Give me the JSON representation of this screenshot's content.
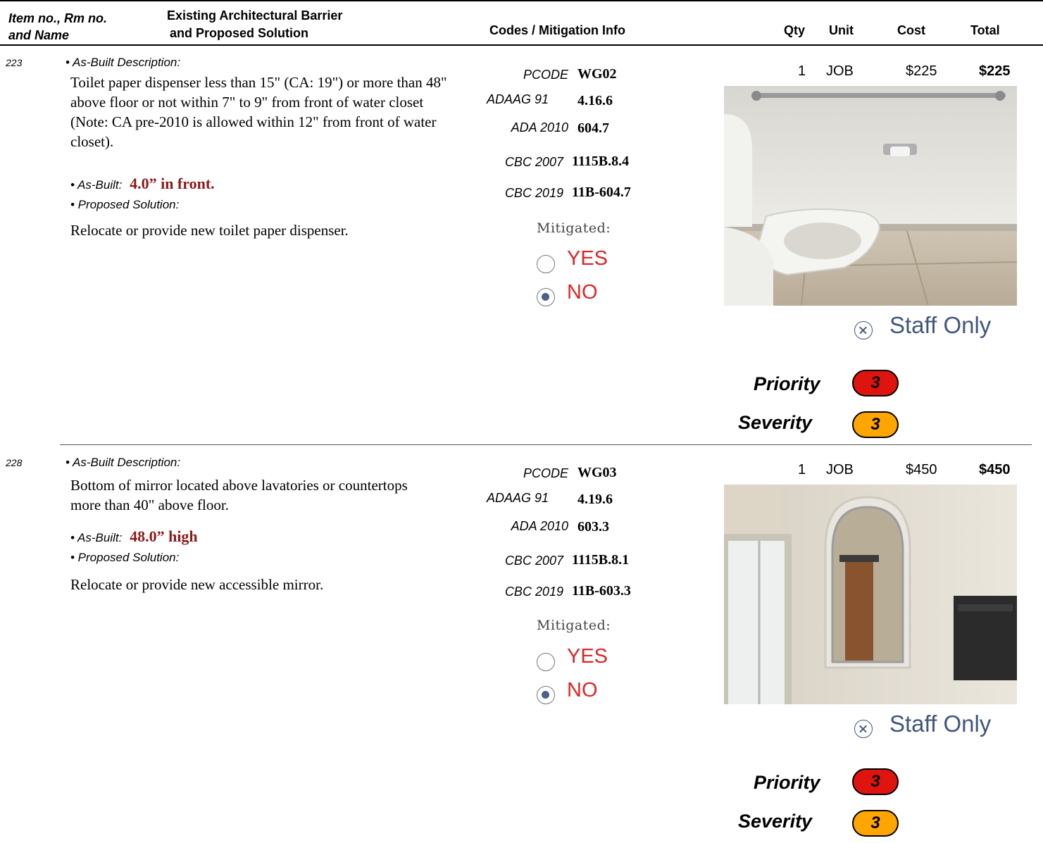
{
  "header": {
    "col_item_line1": "Item no., Rm no.",
    "col_item_line2": "and Name",
    "col_barrier_line1": "Existing Architectural Barrier",
    "col_barrier_line2": "and Proposed Solution",
    "col_codes": "Codes / Mitigation Info",
    "col_qty": "Qty",
    "col_unit": "Unit",
    "col_cost": "Cost",
    "col_total": "Total"
  },
  "labels": {
    "asbuilt_desc": "• As-Built Description:",
    "asbuilt": "• As-Built:",
    "proposed": "• Proposed Solution:",
    "mitigated": "Mitigated:",
    "yes": "YES",
    "no": "NO",
    "staff_only": "Staff Only",
    "priority": "Priority",
    "severity": "Severity"
  },
  "colors": {
    "priority_pill": "#e0140f",
    "severity_pill": "#ffa500",
    "asbuilt_value": "#8b1a1a",
    "option_text": "#e02424",
    "staff_text": "#41567e"
  },
  "items": [
    {
      "number": "223",
      "description": "Toilet paper dispenser less than 15\" (CA: 19\") or more than 48\" above floor or not within 7\" to 9\" from front of water closet (Note: CA pre-2010 is allowed within 12\" from front of water closet).",
      "asbuilt_value": "4.0” in front.",
      "proposed_solution": "Relocate or provide new toilet paper dispenser.",
      "codes": {
        "pcode_label": "PCODE",
        "pcode": "WG02",
        "adaag_label": "ADAAG 91",
        "adaag": "4.16.6",
        "ada_label": "ADA 2010",
        "ada": "604.7",
        "cbc07_label": "CBC 2007",
        "cbc07": "1115B.8.4",
        "cbc19_label": "CBC 2019",
        "cbc19": "11B-604.7"
      },
      "mitigated": "NO",
      "qty": "1",
      "unit": "JOB",
      "cost": "$225",
      "total": "$225",
      "photo": "toilet-photo",
      "priority": "3",
      "severity": "3"
    },
    {
      "number": "228",
      "description": "Bottom of mirror located above lavatories or countertops more than 40\" above floor.",
      "asbuilt_value": "48.0” high",
      "proposed_solution": "Relocate or provide new accessible mirror.",
      "codes": {
        "pcode_label": "PCODE",
        "pcode": "WG03",
        "adaag_label": "ADAAG 91",
        "adaag": "4.19.6",
        "ada_label": "ADA 2010",
        "ada": "603.3",
        "cbc07_label": "CBC 2007",
        "cbc07": "1115B.8.1",
        "cbc19_label": "CBC 2019",
        "cbc19": "11B-603.3"
      },
      "mitigated": "NO",
      "qty": "1",
      "unit": "JOB",
      "cost": "$450",
      "total": "$450",
      "photo": "mirror-photo",
      "priority": "3",
      "severity": "3"
    }
  ]
}
